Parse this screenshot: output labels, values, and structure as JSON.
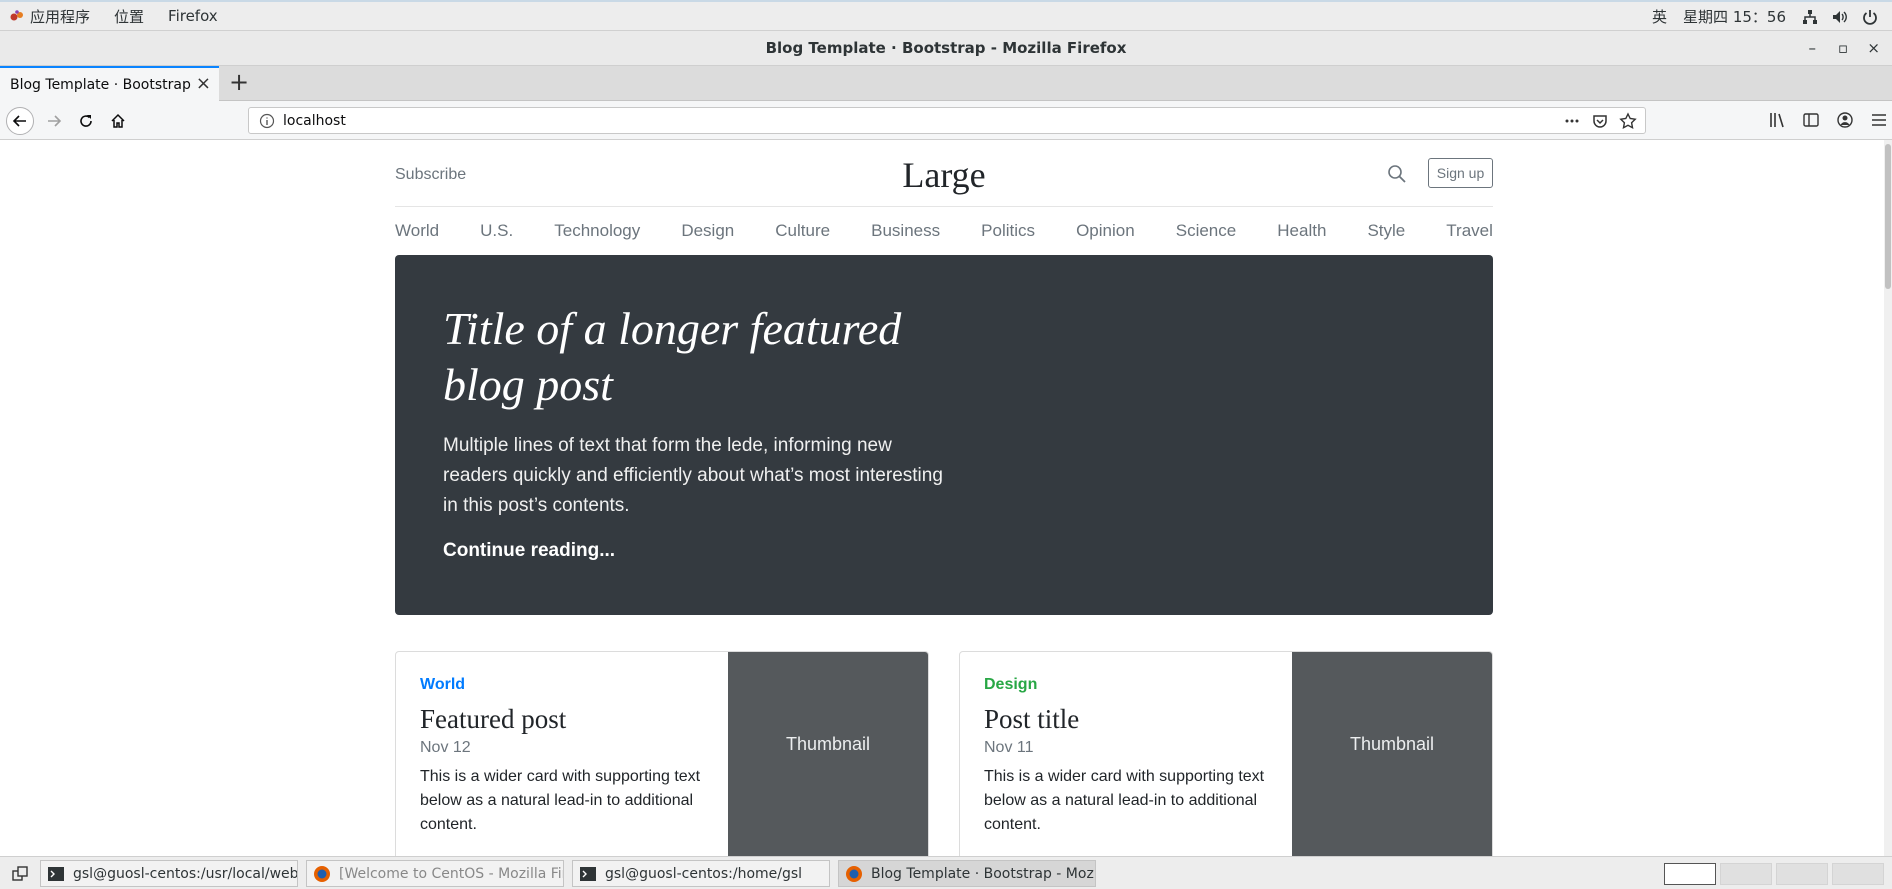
{
  "gnome": {
    "menus": [
      "应用程序",
      "位置",
      "Firefox"
    ],
    "ime": "英",
    "clock": "星期四 15：56",
    "icons": [
      "network-icon",
      "volume-icon",
      "power-icon"
    ]
  },
  "window": {
    "title": "Blog Template · Bootstrap - Mozilla Firefox",
    "minimize": "–",
    "maximize": "▫",
    "close": "×"
  },
  "tabs": [
    {
      "label": "Blog Template · Bootstrap",
      "active": true
    }
  ],
  "newtab": "+",
  "url": "localhost",
  "page": {
    "subscribe": "Subscribe",
    "brand": "Large",
    "signup": "Sign up",
    "nav": [
      "World",
      "U.S.",
      "Technology",
      "Design",
      "Culture",
      "Business",
      "Politics",
      "Opinion",
      "Science",
      "Health",
      "Style",
      "Travel"
    ],
    "jumbotron": {
      "title": "Title of a longer featured blog post",
      "lede": "Multiple lines of text that form the lede, informing new readers quickly and efficiently about what’s most interesting in this post’s contents.",
      "link": "Continue reading..."
    },
    "cards": [
      {
        "category": "World",
        "category_color": "#007bff",
        "title": "Featured post",
        "date": "Nov 12",
        "text": "This is a wider card with supporting text below as a natural lead-in to additional content.",
        "thumb": "Thumbnail"
      },
      {
        "category": "Design",
        "category_color": "#28a745",
        "title": "Post title",
        "date": "Nov 11",
        "text": "This is a wider card with supporting text below as a natural lead-in to additional content.",
        "thumb": "Thumbnail"
      }
    ]
  },
  "taskbar": [
    {
      "label": "gsl@guosl-centos:/usr/local/webser···",
      "icon": "terminal-icon"
    },
    {
      "label": "[Welcome to CentOS - Mozilla Firef···",
      "icon": "firefox-icon"
    },
    {
      "label": "gsl@guosl-centos:/home/gsl",
      "icon": "terminal-icon"
    },
    {
      "label": "Blog Template · Bootstrap - Mozilla···",
      "icon": "firefox-icon",
      "active": true
    }
  ],
  "workspaces": 4
}
